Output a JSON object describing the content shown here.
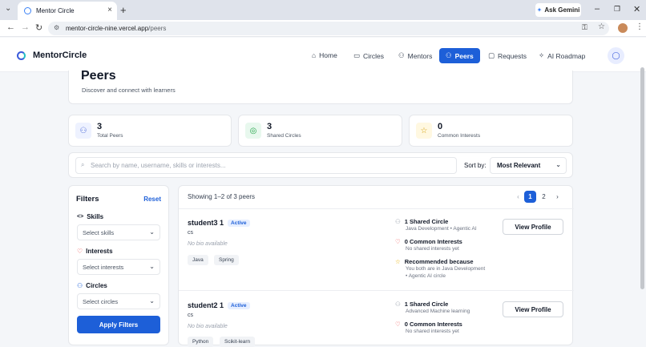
{
  "browser": {
    "tab_title": "Mentor Circle",
    "new_tab": "+",
    "ask_gemini": "Ask Gemini",
    "url_host": "mentor-circle-nine.vercel.app",
    "url_path": "/peers"
  },
  "header": {
    "brand": "MentorCircle",
    "nav": [
      {
        "label": "Home",
        "icon": "home-icon"
      },
      {
        "label": "Circles",
        "icon": "book-icon"
      },
      {
        "label": "Mentors",
        "icon": "mentor-icon"
      },
      {
        "label": "Peers",
        "icon": "users-icon",
        "active": true
      },
      {
        "label": "Requests",
        "icon": "message-icon"
      },
      {
        "label": "AI Roadmap",
        "icon": "sparkle-icon"
      }
    ]
  },
  "page": {
    "title": "Peers",
    "subtitle": "Discover and connect with learners"
  },
  "stats": [
    {
      "value": "3",
      "label": "Total Peers",
      "icon": "users-icon",
      "color": "#eef2ff"
    },
    {
      "value": "3",
      "label": "Shared Circles",
      "icon": "target-icon",
      "color": "#e8f8ee"
    },
    {
      "value": "0",
      "label": "Common Interests",
      "icon": "star-icon",
      "color": "#fff8e1"
    }
  ],
  "search": {
    "placeholder": "Search by name, username, skills or interests...",
    "sort_label": "Sort by:",
    "sort_value": "Most Relevant"
  },
  "filters": {
    "title": "Filters",
    "reset": "Reset",
    "skills_label": "Skills",
    "skills_placeholder": "Select skills",
    "interests_label": "Interests",
    "interests_placeholder": "Select interests",
    "circles_label": "Circles",
    "circles_placeholder": "Select circles",
    "apply": "Apply Filters"
  },
  "results": {
    "showing": "Showing 1–2 of 3 peers",
    "pages": [
      "1",
      "2"
    ],
    "prev": "‹",
    "next": "›",
    "peers": [
      {
        "name": "student3 1",
        "status": "Active",
        "dept": "cs",
        "bio": "No bio available",
        "tags": [
          "Java",
          "Spring"
        ],
        "circles_title": "1 Shared Circle",
        "circles_sub": "Java Development • Agentic AI",
        "interests_title": "0 Common Interests",
        "interests_sub": "No shared interests yet",
        "recommended_title": "Recommended because",
        "recommended_sub1": "You both are in Java Development",
        "recommended_sub2": "• Agentic AI circle",
        "view": "View Profile"
      },
      {
        "name": "student2 1",
        "status": "Active",
        "dept": "cs",
        "bio": "No bio available",
        "tags": [
          "Python",
          "Scikit-learn"
        ],
        "circles_title": "1 Shared Circle",
        "circles_sub": "Advanced Machine learning",
        "interests_title": "0 Common Interests",
        "interests_sub": "No shared interests yet",
        "view": "View Profile"
      }
    ]
  }
}
